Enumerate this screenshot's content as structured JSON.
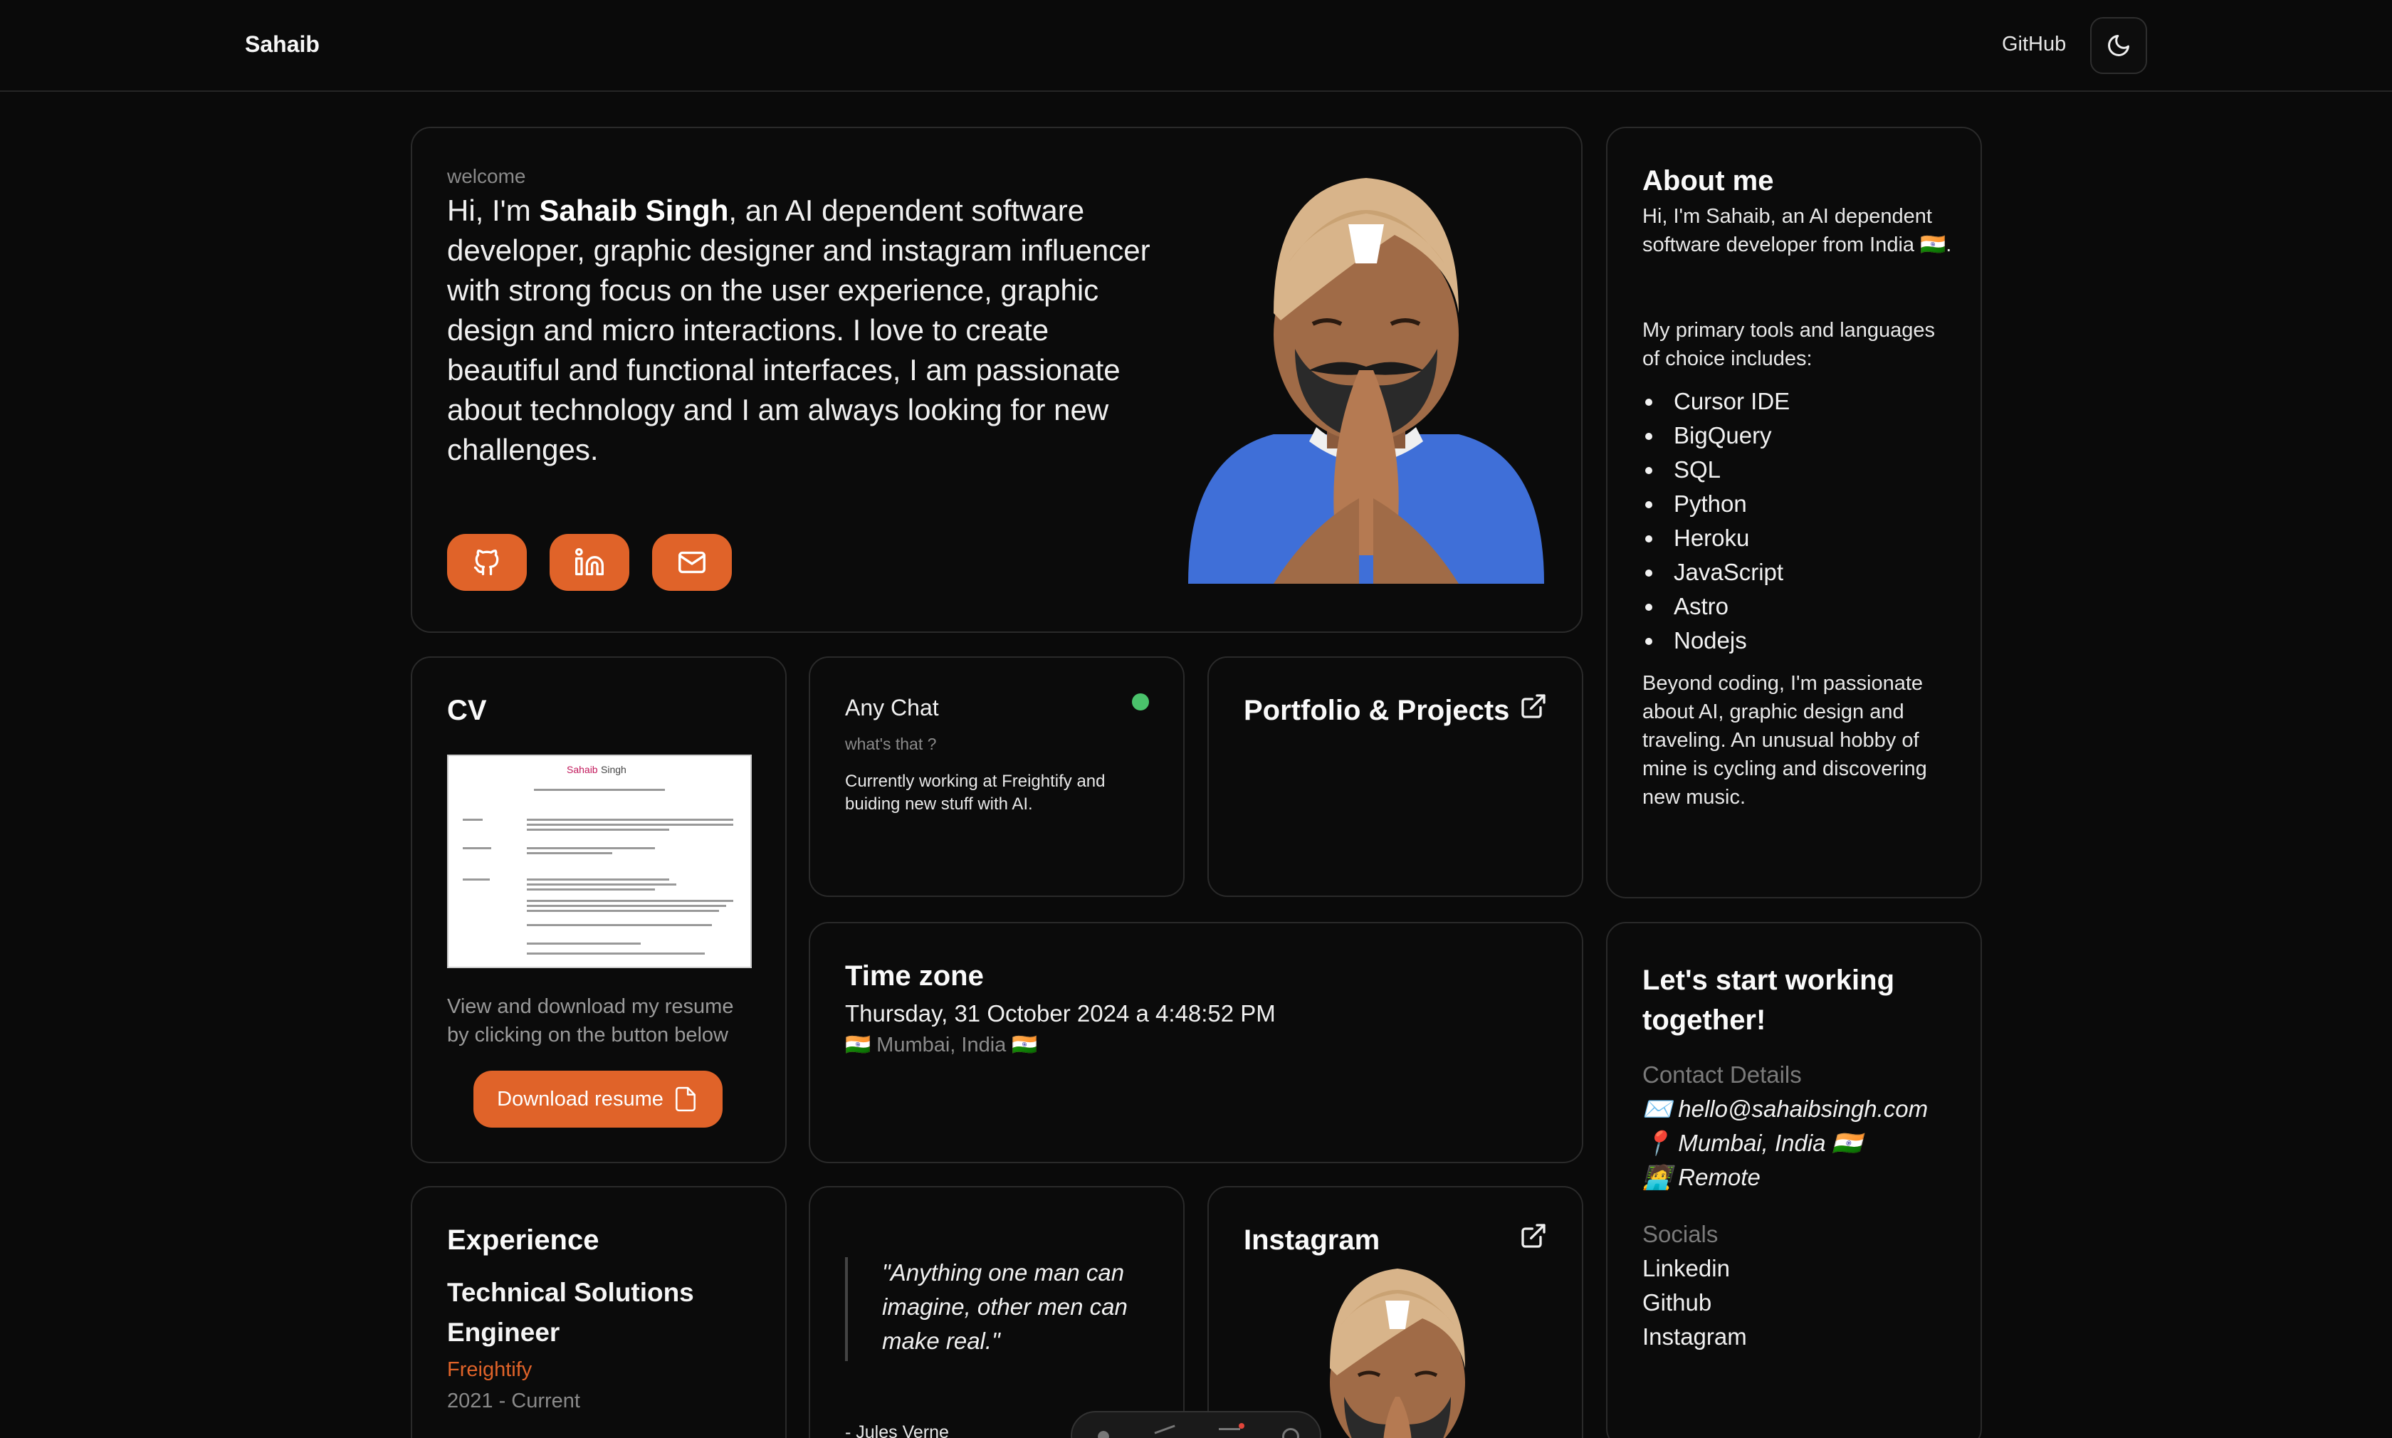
{
  "header": {
    "brand": "Sahaib",
    "github_label": "GitHub"
  },
  "hero": {
    "welcome": "welcome",
    "intro_prefix": "Hi, I'm ",
    "intro_name": "Sahaib Singh",
    "intro_rest": ", an AI dependent software developer, graphic designer and instagram influencer with strong focus on the user experience, graphic design and micro interactions. I love to create beautiful and functional interfaces, I am passionate about technology and I am always looking for new challenges.",
    "socials": [
      "github-icon",
      "linkedin-icon",
      "mail-icon"
    ]
  },
  "about": {
    "title": "About me",
    "intro": "Hi, I'm Sahaib, an AI dependent software developer from India 🇮🇳.",
    "tools_intro": "My primary tools and languages of choice includes:",
    "tools": [
      "Cursor IDE",
      "BigQuery",
      "SQL",
      "Python",
      "Heroku",
      "JavaScript",
      "Astro",
      "Nodejs"
    ],
    "outro": "Beyond coding, I'm passionate about AI, graphic design and traveling. An unusual hobby of mine is cycling and discovering new music."
  },
  "cv": {
    "title": "CV",
    "thumb_name_first": "Sahaib",
    "thumb_name_last": " Singh",
    "description": "View and download my resume by clicking on the button below",
    "button": "Download resume"
  },
  "chat": {
    "title": "Any Chat",
    "subtitle": "what's that ?",
    "body": "Currently working at Freightify and buiding new stuff with AI.",
    "status_color": "#4ac26b"
  },
  "portfolio": {
    "title": "Portfolio & Projects"
  },
  "timezone": {
    "title": "Time zone",
    "datetime": "Thursday, 31 October 2024 a 4:48:52 PM",
    "location": "🇮🇳 Mumbai, India 🇮🇳"
  },
  "contact": {
    "title": "Let's start working together!",
    "details_label": "Contact Details",
    "email": "✉️ hello@sahaibsingh.com",
    "location": "📍 Mumbai, India 🇮🇳",
    "remote": "🧑‍💻 Remote",
    "socials_label": "Socials",
    "socials": [
      "Linkedin",
      "Github",
      "Instagram"
    ]
  },
  "experience": {
    "title": "Experience",
    "role": "Technical Solutions Engineer",
    "company": "Freightify",
    "years": "2021 - Current"
  },
  "quote": {
    "text": "\"Anything one man can imagine, other men can make real.\"",
    "author": "- Jules Verne"
  },
  "instagram": {
    "title": "Instagram"
  },
  "colors": {
    "accent": "#e06329",
    "background": "#0a0a0a",
    "card_border": "#2a2a2a"
  }
}
